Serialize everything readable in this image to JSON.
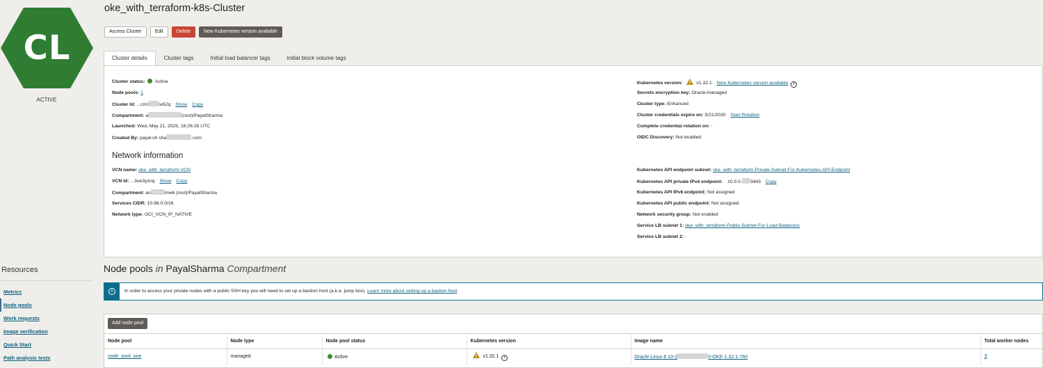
{
  "avatar": {
    "initials": "CL",
    "color": "#2e7d32",
    "status": "ACTIVE"
  },
  "resources": {
    "title": "Resources",
    "items": [
      "Metrics",
      "Node pools",
      "Work requests",
      "Image verification",
      "Quick Start",
      "Path analysis tests"
    ],
    "active": "Node pools"
  },
  "header": {
    "title": "oke_with_terraform-k8s-Cluster",
    "buttons": {
      "access": "Access Cluster",
      "edit": "Edit",
      "delete": "Delete",
      "upgrade": "New Kubernetes version available"
    }
  },
  "tabs": [
    "Cluster details",
    "Cluster tags",
    "Initial load balancer tags",
    "Initial block volume tags"
  ],
  "details": {
    "left": {
      "cluster_status_label": "Cluster status:",
      "cluster_status_value": "Active",
      "node_pools_label": "Node pools:",
      "node_pools_value": "1",
      "cluster_id_label": "Cluster Id:",
      "cluster_id_value_a": "...crin",
      "cluster_id_value_b": "w52q",
      "show": "Show",
      "copy": "Copy",
      "compartment_label": "Compartment:",
      "compartment_value_a": "a",
      "compartment_value_b": "(root)/PayalSharma",
      "launched_label": "Launched:",
      "launched_value": "Wed, May 21, 2025, 16:26:28 UTC",
      "created_by_label": "Created By:",
      "created_by_value_a": "payal.sh sha",
      "created_by_value_b": ".com"
    },
    "right": {
      "k8s_version_label": "Kubernetes version:",
      "k8s_version_value": "v1.32.1",
      "k8s_version_link": "New Kubernetes version available",
      "secrets_label": "Secrets encryption key:",
      "secrets_value": "Oracle-managed",
      "type_label": "Cluster type:",
      "type_value": "Enhanced",
      "cred_label": "Cluster credentials expire on:",
      "cred_value": "5/21/2030",
      "cred_link": "Start Rotation",
      "rotation_label": "Complete credential rotation on:",
      "rotation_value": "-",
      "oidc_label": "OIDC Discovery:",
      "oidc_value": "Not enabled"
    }
  },
  "network": {
    "title": "Network information",
    "left": {
      "vcn_name_label": "VCN name:",
      "vcn_name_value": "oke_with_terraform-VCN",
      "vcn_id_label": "VCN Id:",
      "vcn_id_value": "...3oe3yznq",
      "show": "Show",
      "copy": "Copy",
      "compartment_label": "Compartment:",
      "compartment_value_a": "an",
      "compartment_value_b": "mw6 (root)/PayalSharma",
      "cidr_label": "Services CIDR:",
      "cidr_value": "10.96.0.0/16",
      "net_type_label": "Network type:",
      "net_type_value": "OCI_VCN_IP_NATIVE"
    },
    "right": {
      "api_subnet_label": "Kubernetes API endpoint subnet:",
      "api_subnet_value": "oke_with_terraform-Private-Subnet-For-Kubernetes-API-Endpoint",
      "ipv4_label": "Kubernetes API private IPv4 endpoint:",
      "ipv4_value_a": "10.0.0.",
      "ipv4_value_b": "3443",
      "copy": "Copy",
      "ipv6_label": "Kubernetes API IPv6 endpoint:",
      "ipv6_value": "Not assigned",
      "public_label": "Kubernetes API public endpoint:",
      "public_value": "Not assigned",
      "nsg_label": "Network security group:",
      "nsg_value": "Not enabled",
      "lb1_label": "Service LB subnet 1:",
      "lb1_value": "oke_with_terraform-Public-Subnet-For-Load-Balancers",
      "lb2_label": "Service LB subnet 2:",
      "lb2_value": "-"
    }
  },
  "node_pools": {
    "title": "Node pools",
    "in": "in",
    "compartment_name": "PayalSharma",
    "compartment_word": "Compartment",
    "alert_text": "In order to access your private nodes with a public SSH key you will need to set up a bastion host (a.k.a. jump box).",
    "alert_link": "Learn more about setting up a bastion host",
    "add_button": "Add node pool",
    "columns": [
      "Node pool",
      "Node type",
      "Node pool status",
      "Kubernetes version",
      "Image name",
      "Total worker nodes"
    ],
    "rows": [
      {
        "name": "node_pool_one",
        "type": "managed",
        "status": "Active",
        "version": "v1.32.1",
        "image_a": "Oracle-Linux-8.10-2",
        "image_b": "0-OKE-1.32.1-760",
        "workers": "3"
      }
    ]
  }
}
